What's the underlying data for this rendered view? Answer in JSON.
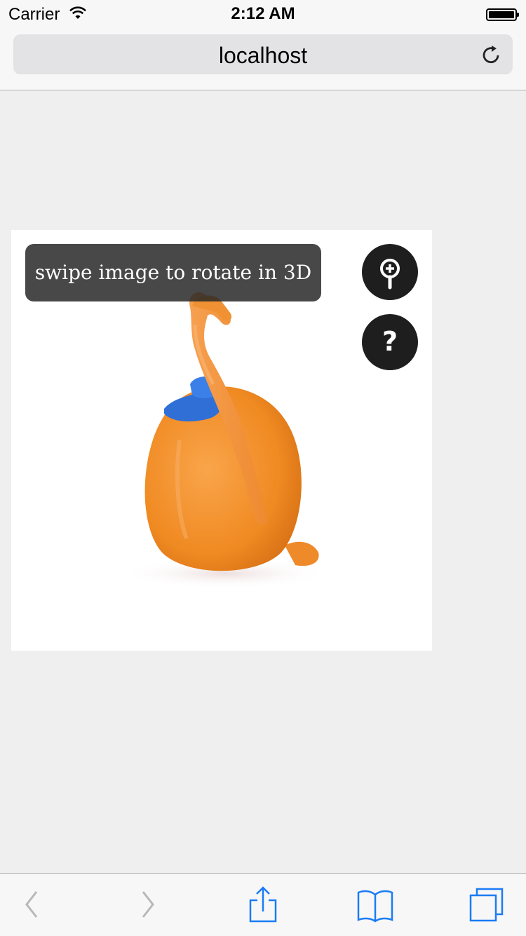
{
  "status_bar": {
    "carrier": "Carrier",
    "time": "2:12 AM"
  },
  "browser": {
    "url": "localhost"
  },
  "viewer": {
    "hint": "swipe image to rotate in 3D",
    "zoom_icon": "zoom-in-icon",
    "help_icon": "help-icon",
    "help_glyph": "?"
  },
  "toolbar": {
    "back_icon": "back-chevron-icon",
    "forward_icon": "forward-chevron-icon",
    "share_icon": "share-icon",
    "bookmarks_icon": "bookmarks-icon",
    "tabs_icon": "tabs-icon",
    "accent": "#1a7cf5",
    "disabled": "#b8b8b8"
  }
}
